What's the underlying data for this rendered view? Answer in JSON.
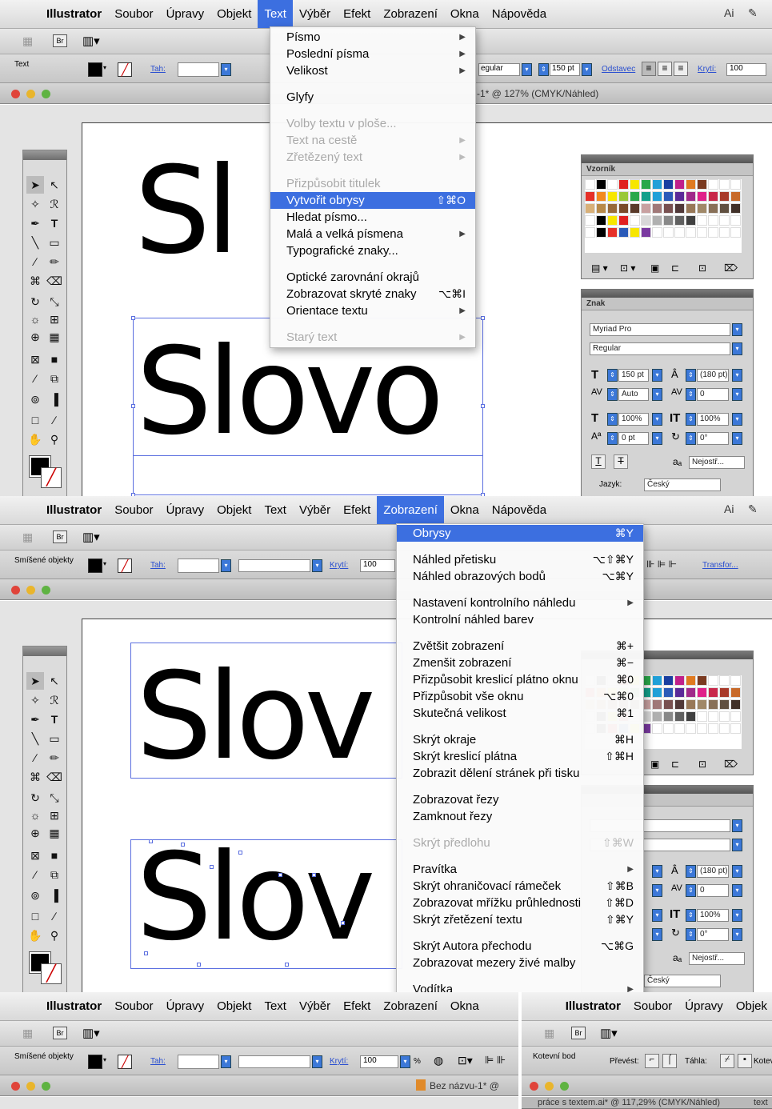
{
  "menubar": {
    "app": "Illustrator",
    "items": [
      "Soubor",
      "Úpravy",
      "Objekt",
      "Text",
      "Výběr",
      "Efekt",
      "Zobrazení",
      "Okna",
      "Nápověda"
    ]
  },
  "panel1": {
    "control_label": "Text",
    "tah_label": "Tah:",
    "font_style_value": "egular",
    "font_size_value": "150 pt",
    "odstavec_label": "Odstavec",
    "kryti_label": "Krytí:",
    "kryti_value": "100",
    "doc_title": "-1* @ 127% (CMYK/Náhled)",
    "word": "Slovo",
    "word_top": "Sl",
    "text_menu": {
      "items": [
        {
          "label": "Písmo",
          "submenu": true
        },
        {
          "label": "Poslední písma",
          "submenu": true
        },
        {
          "label": "Velikost",
          "submenu": true
        },
        {
          "sep": true
        },
        {
          "label": "Glyfy"
        },
        {
          "sep": true
        },
        {
          "label": "Volby textu v ploše...",
          "disabled": true
        },
        {
          "label": "Text na cestě",
          "disabled": true,
          "submenu": true
        },
        {
          "label": "Zřetězený text",
          "disabled": true,
          "submenu": true
        },
        {
          "sep": true
        },
        {
          "label": "Přizpůsobit titulek",
          "disabled": true
        },
        {
          "label": "Vytvořit obrysy",
          "shortcut": "⇧⌘O",
          "highlighted": true
        },
        {
          "label": "Hledat písmo..."
        },
        {
          "label": "Malá a velká písmena",
          "submenu": true
        },
        {
          "label": "Typografické znaky..."
        },
        {
          "sep": true
        },
        {
          "label": "Optické zarovnání okrajů"
        },
        {
          "label": "Zobrazovat skryté znaky",
          "shortcut": "⌥⌘I"
        },
        {
          "label": "Orientace textu",
          "submenu": true
        },
        {
          "sep": true
        },
        {
          "label": "Starý text",
          "disabled": true,
          "submenu": true
        }
      ]
    },
    "swatches_tab": "Vzorník",
    "char_panel": {
      "tab": "Znak",
      "font": "Myriad Pro",
      "style": "Regular",
      "size": "150 pt",
      "leading": "(180 pt)",
      "kerning": "Auto",
      "tracking": "0",
      "vscale": "100%",
      "hscale": "100%",
      "baseline": "0 pt",
      "rotation": "0°",
      "aa": "Nejostř...",
      "lang_label": "Jazyk:",
      "lang": "Český"
    }
  },
  "panel2": {
    "control_label": "Smíšené objekty",
    "tah_label": "Tah:",
    "kryti_label": "Krytí:",
    "kryti_value": "100",
    "transform_label": "Transfor...",
    "word": "Slov",
    "view_menu": {
      "items": [
        {
          "label": "Obrysy",
          "shortcut": "⌘Y",
          "highlighted": true
        },
        {
          "sep": true
        },
        {
          "label": "Náhled přetisku",
          "shortcut": "⌥⇧⌘Y"
        },
        {
          "label": "Náhled obrazových bodů",
          "shortcut": "⌥⌘Y"
        },
        {
          "sep": true
        },
        {
          "label": "Nastavení kontrolního náhledu",
          "submenu": true
        },
        {
          "label": "Kontrolní náhled barev"
        },
        {
          "sep": true
        },
        {
          "label": "Zvětšit zobrazení",
          "shortcut": "⌘+"
        },
        {
          "label": "Zmenšit zobrazení",
          "shortcut": "⌘−"
        },
        {
          "label": "Přizpůsobit kreslicí plátno oknu",
          "shortcut": "⌘0"
        },
        {
          "label": "Přizpůsobit vše oknu",
          "shortcut": "⌥⌘0"
        },
        {
          "label": "Skutečná velikost",
          "shortcut": "⌘1"
        },
        {
          "sep": true
        },
        {
          "label": "Skrýt okraje",
          "shortcut": "⌘H"
        },
        {
          "label": "Skrýt kreslicí plátna",
          "shortcut": "⇧⌘H"
        },
        {
          "label": "Zobrazit dělení stránek při tisku"
        },
        {
          "sep": true
        },
        {
          "label": "Zobrazovat řezy"
        },
        {
          "label": "Zamknout řezy"
        },
        {
          "sep": true
        },
        {
          "label": "Skrýt předlohu",
          "shortcut": "⇧⌘W",
          "disabled": true
        },
        {
          "sep": true
        },
        {
          "label": "Pravítka",
          "submenu": true
        },
        {
          "label": "Skrýt ohraničovací rámeček",
          "shortcut": "⇧⌘B"
        },
        {
          "label": "Zobrazovat mřížku průhlednosti",
          "shortcut": "⇧⌘D"
        },
        {
          "label": "Skrýt zřetězení textu",
          "shortcut": "⇧⌘Y"
        },
        {
          "sep": true
        },
        {
          "label": "Skrýt Autora přechodu",
          "shortcut": "⌥⌘G"
        },
        {
          "label": "Zobrazovat mezery živé malby"
        },
        {
          "sep": true
        },
        {
          "label": "Vodítka",
          "submenu": true
        }
      ]
    },
    "char_panel": {
      "leading": "(180 pt)",
      "tracking": "0",
      "hscale": "100%",
      "rotation": "0°",
      "aa": "Nejostř...",
      "lang": "Český"
    }
  },
  "panel3": {
    "control_label": "Smíšené objekty",
    "tah_label": "Tah:",
    "kryti_label": "Krytí:",
    "kryti_value": "100",
    "percent": "%",
    "doc_title": "Bez názvu-1* @"
  },
  "panel4": {
    "menubar_items": [
      "Soubor",
      "Úpravy",
      "Objek"
    ],
    "control_label": "Kotevní bod",
    "prevest_label": "Převést:",
    "tahla_label": "Táhla:",
    "kotev_label": "Kotev",
    "doc_title": "práce s textem.ai* @ 117,29% (CMYK/Náhled)",
    "doc_title2": "text"
  },
  "colors": {
    "menu_highlight": "#3c6fe0",
    "selection": "#5b6fe0"
  }
}
